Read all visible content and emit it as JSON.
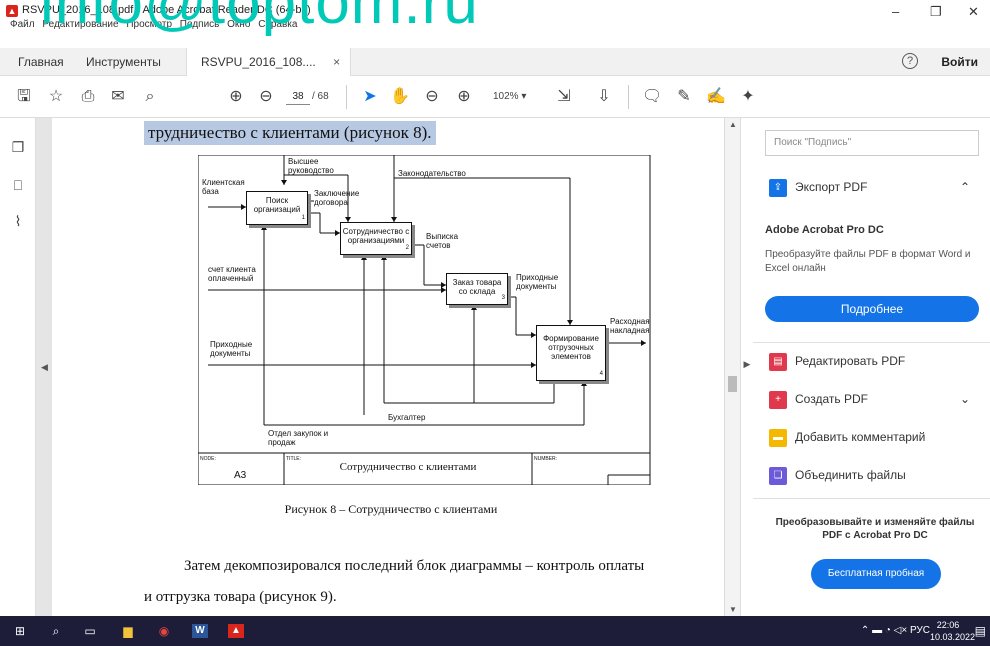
{
  "window": {
    "title": "RSVPU_2016_108.pdf - Adobe Acrobat Reader DC (64-bit)",
    "watermark": "info@toptom.ru",
    "menu": [
      "Файл",
      "Редактирование",
      "Просмотр",
      "Подпись",
      "Окно",
      "Справка"
    ],
    "minimize": "–",
    "maximize": "❐",
    "close": "✕"
  },
  "tabs": {
    "home": "Главная",
    "tools": "Инструменты",
    "document": "RSVPU_2016_108....",
    "close": "×",
    "signin": "Войти",
    "help": "?"
  },
  "toolbar": {
    "page_current": "38",
    "page_total": "/  68",
    "zoom": "102%"
  },
  "document": {
    "highlighted_line": "трудничество с клиентами (рисунок 8).",
    "figure_caption": "Рисунок 8 – Сотрудничество с клиентами",
    "paragraph_line1": "Затем декомпозировался последний блок диаграммы – контроль оплаты",
    "paragraph_line2": "и отгрузка товара (рисунок 9)."
  },
  "diagram": {
    "labels": {
      "top_management": "Высшее\nруководство",
      "legislation": "Законодательство",
      "client_base": "Клиентская\nбаза",
      "contract": "Заключение\nдоговора",
      "invoicing": "Выписка\nсчетов",
      "client_invoice": "счет клиента\nоплаченный",
      "incoming_docs_right": "Приходные\nдокументы",
      "delivery_note": "Расходная\nнакладная",
      "incoming_docs_left": "Приходные\nдокументы",
      "accountant": "Бухгалтер",
      "procurement": "Отдел закупок и\nпродаж"
    },
    "boxes": [
      {
        "name": "Поиск\nорганизаций",
        "num": "1"
      },
      {
        "name": "Сотрудничество с\nорганизациями",
        "num": "2"
      },
      {
        "name": "Заказ товара\nсо склада",
        "num": "3"
      },
      {
        "name": "Формирование\nотгрузочных\nэлементов",
        "num": "4"
      }
    ],
    "frame": {
      "node_label": "NODE:",
      "node_value": "A3",
      "title_label": "TITLE:",
      "title_value": "Сотрудничество с клиентами",
      "number_label": "NUMBER:"
    }
  },
  "right_pane": {
    "search_placeholder": "Поиск \"Подпись\"",
    "export_pdf": "Экспорт PDF",
    "promo_title": "Adobe Acrobat Pro DC",
    "promo_text": "Преобразуйте файлы PDF в формат Word и Excel онлайн",
    "more_button": "Подробнее",
    "edit_pdf": "Редактировать PDF",
    "create_pdf": "Создать PDF",
    "add_comment": "Добавить комментарий",
    "combine_files": "Объединить файлы",
    "convert_title": "Преобразовывайте и изменяйте файлы PDF с Acrobat Pro DC",
    "trial_button": "Бесплатная пробная версия"
  },
  "taskbar": {
    "lang": "РУС",
    "time": "22:06",
    "date": "10.03.2022"
  },
  "colors": {
    "accent": "#1473e6",
    "highlight": "#b7c8e2",
    "watermark": "#00c9b7",
    "taskbar": "#1d1d3a"
  }
}
